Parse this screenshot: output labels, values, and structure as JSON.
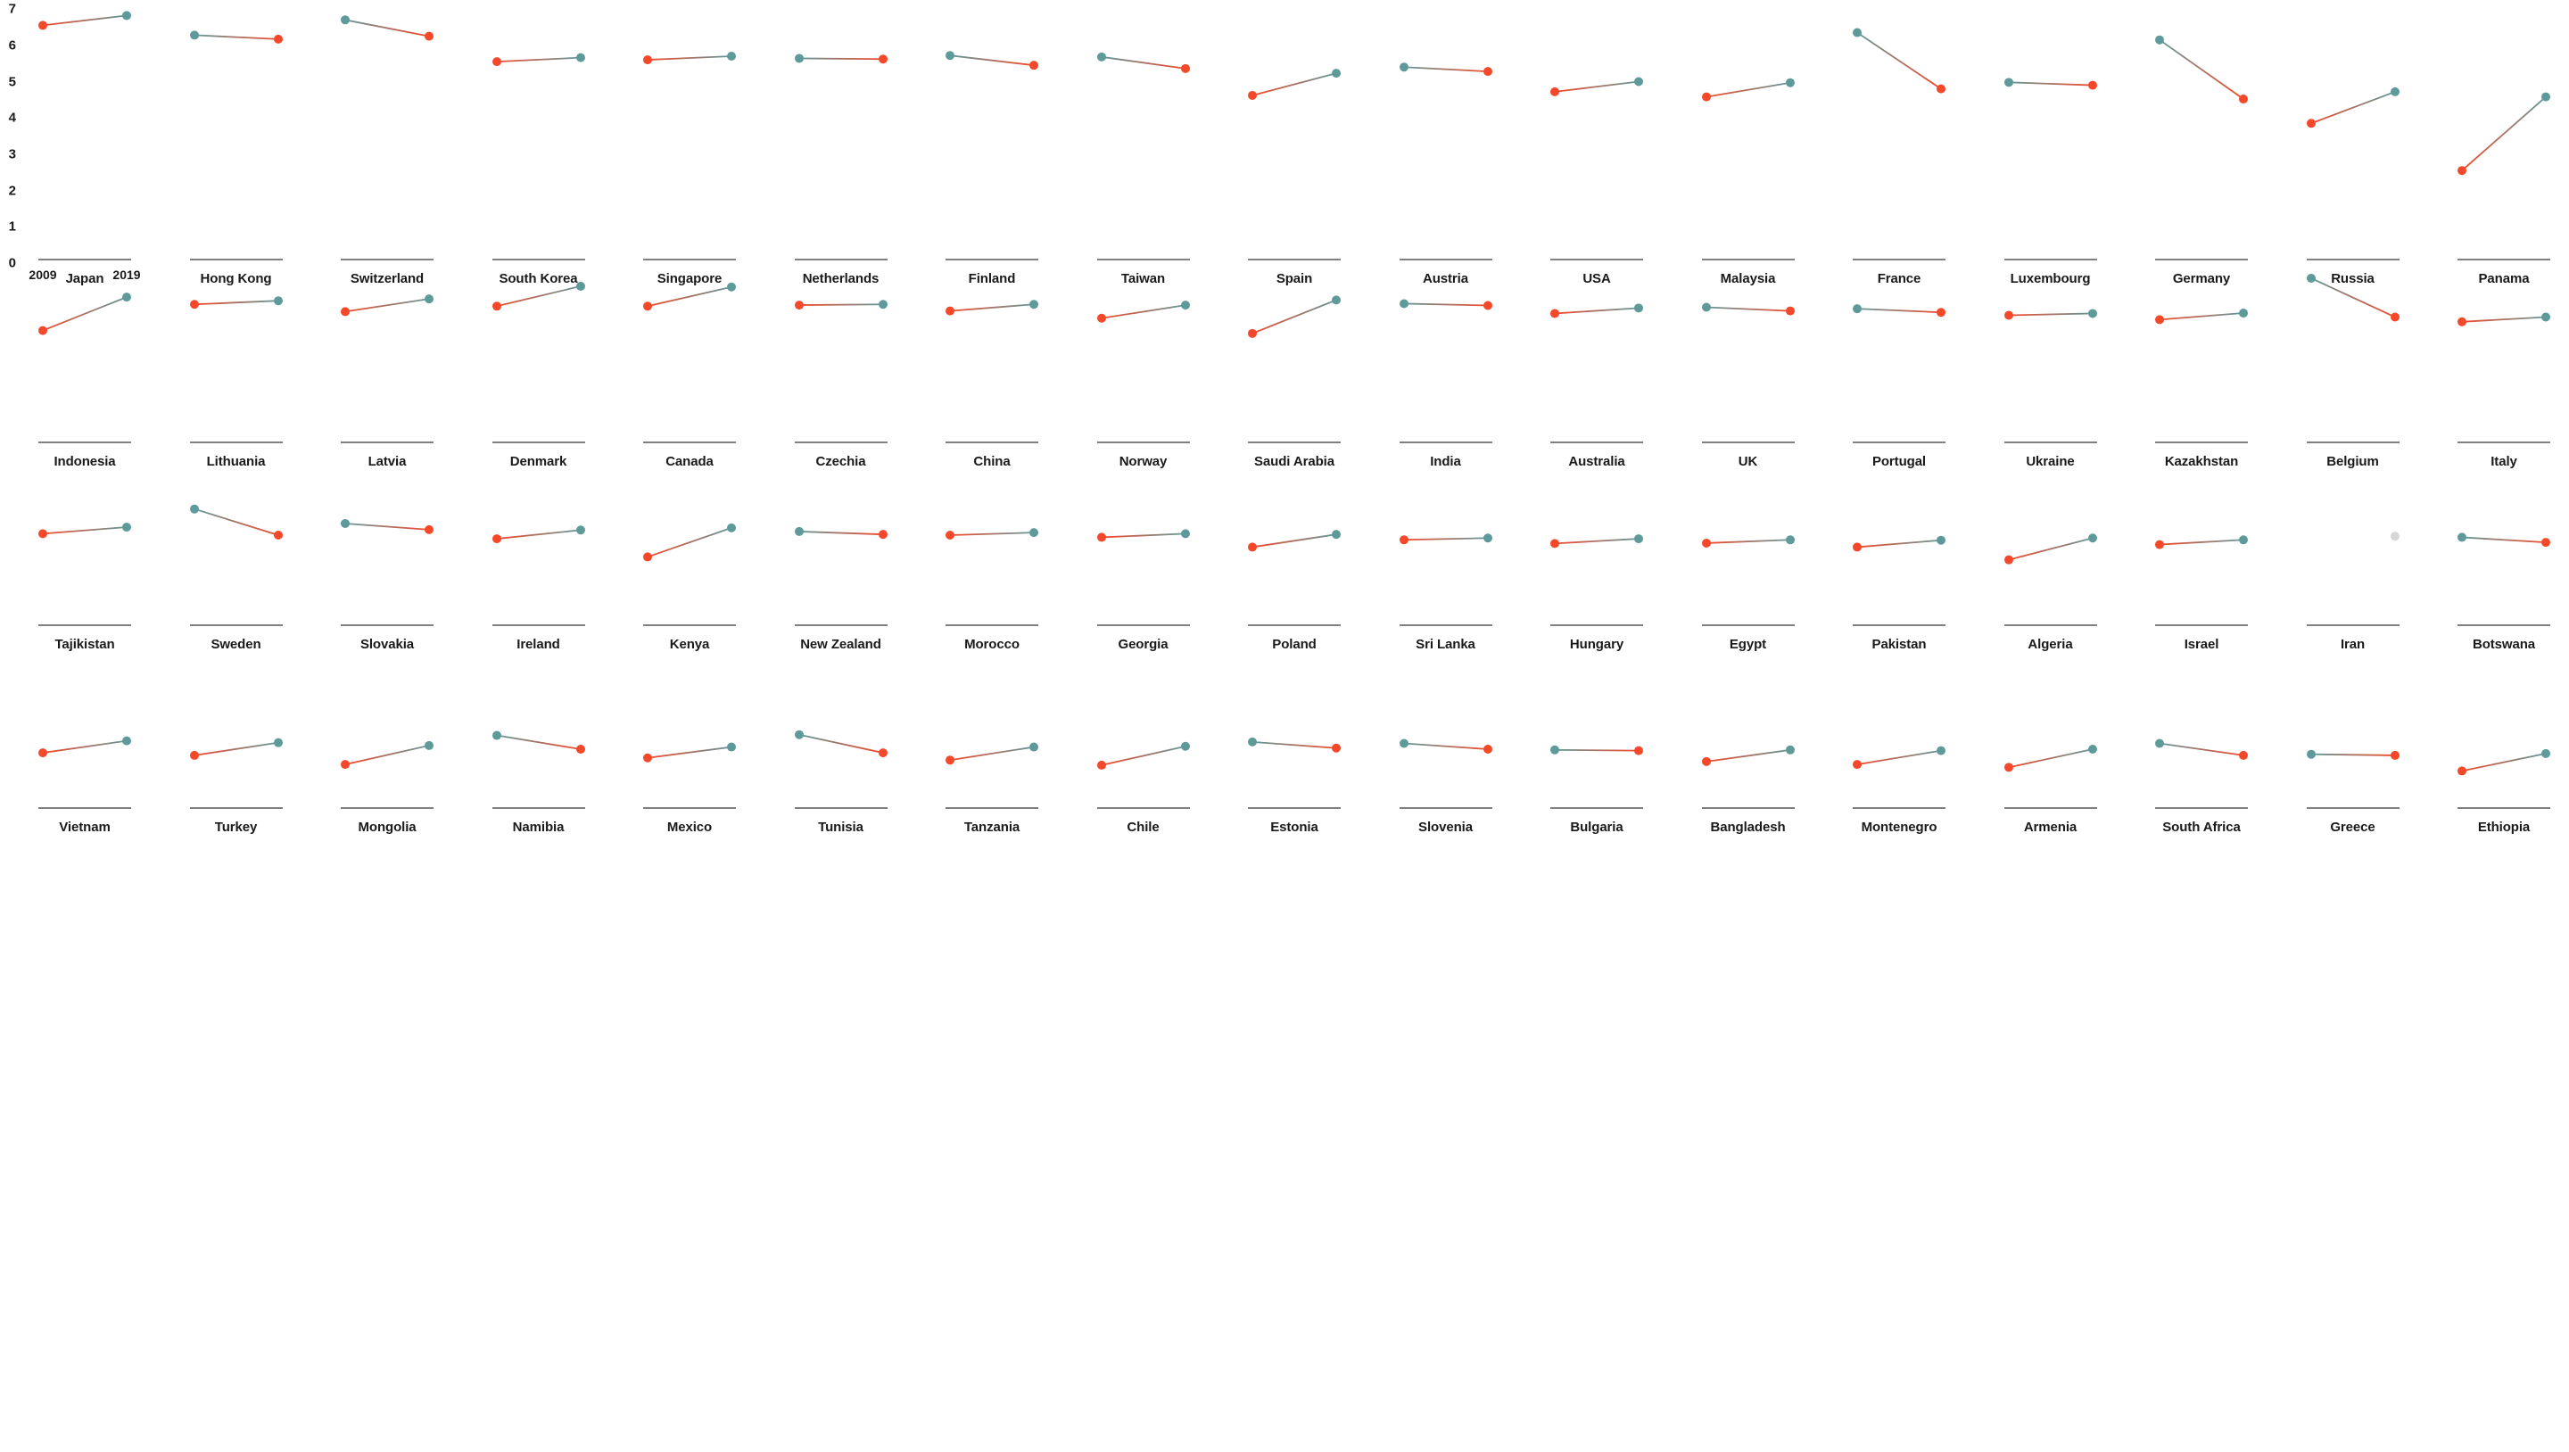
{
  "chart_data": {
    "type": "line",
    "title": "",
    "subtitle": "",
    "xlabel": "",
    "ylabel": "",
    "x": [
      2009,
      2019
    ],
    "x_tick_labels": [
      "2009",
      "2019"
    ],
    "ylim": [
      0,
      7
    ],
    "y_tick_labels": [
      "0",
      "1",
      "2",
      "3",
      "4",
      "5",
      "6",
      "7"
    ],
    "y_ticks": [
      0,
      1,
      2,
      3,
      4,
      5,
      6,
      7
    ],
    "grid": false,
    "legend_position": "none",
    "colors": {
      "low_point": "#f4482a",
      "high_point": "#5f9a9b",
      "missing_point": "#d6d6d6",
      "baseline": "#808080",
      "text": "#1a1a1a",
      "background": "#ffffff"
    },
    "encoding_note": "Red marker = lower of the two values; teal marker = higher of the two values; grey marker = single available value.",
    "columns_per_row": 17,
    "rows": 4,
    "series": [
      {
        "name": "Japan",
        "row": 0,
        "col": 0,
        "values": [
          6.55,
          6.82
        ]
      },
      {
        "name": "Hong Kong",
        "row": 0,
        "col": 1,
        "values": [
          6.28,
          6.17
        ]
      },
      {
        "name": "Switzerland",
        "row": 0,
        "col": 2,
        "values": [
          6.7,
          6.25
        ]
      },
      {
        "name": "South Korea",
        "row": 0,
        "col": 3,
        "values": [
          5.55,
          5.66
        ]
      },
      {
        "name": "Singapore",
        "row": 0,
        "col": 4,
        "values": [
          5.6,
          5.7
        ]
      },
      {
        "name": "Netherlands",
        "row": 0,
        "col": 5,
        "values": [
          5.64,
          5.62
        ]
      },
      {
        "name": "Finland",
        "row": 0,
        "col": 6,
        "values": [
          5.72,
          5.45
        ]
      },
      {
        "name": "Taiwan",
        "row": 0,
        "col": 7,
        "values": [
          5.68,
          5.36
        ]
      },
      {
        "name": "Spain",
        "row": 0,
        "col": 8,
        "values": [
          4.62,
          5.23
        ]
      },
      {
        "name": "Austria",
        "row": 0,
        "col": 9,
        "values": [
          5.4,
          5.28
        ]
      },
      {
        "name": "USA",
        "row": 0,
        "col": 10,
        "values": [
          4.72,
          5.0
        ]
      },
      {
        "name": "Malaysia",
        "row": 0,
        "col": 11,
        "values": [
          4.58,
          4.97
        ]
      },
      {
        "name": "France",
        "row": 0,
        "col": 12,
        "values": [
          6.35,
          4.8
        ]
      },
      {
        "name": "Luxembourg",
        "row": 0,
        "col": 13,
        "values": [
          4.98,
          4.9
        ]
      },
      {
        "name": "Germany",
        "row": 0,
        "col": 14,
        "values": [
          6.15,
          4.52
        ]
      },
      {
        "name": "Russia",
        "row": 0,
        "col": 15,
        "values": [
          3.85,
          4.72
        ]
      },
      {
        "name": "Panama",
        "row": 0,
        "col": 16,
        "values": [
          2.55,
          4.58
        ]
      },
      {
        "name": "Indonesia",
        "row": 1,
        "col": 0,
        "values": [
          3.18,
          4.1
        ]
      },
      {
        "name": "Lithuania",
        "row": 1,
        "col": 1,
        "values": [
          3.9,
          4.0
        ]
      },
      {
        "name": "Latvia",
        "row": 1,
        "col": 2,
        "values": [
          3.7,
          4.05
        ]
      },
      {
        "name": "Denmark",
        "row": 1,
        "col": 3,
        "values": [
          3.85,
          4.4
        ]
      },
      {
        "name": "Canada",
        "row": 1,
        "col": 4,
        "values": [
          3.85,
          4.38
        ]
      },
      {
        "name": "Czechia",
        "row": 1,
        "col": 5,
        "values": [
          3.88,
          3.9
        ]
      },
      {
        "name": "China",
        "row": 1,
        "col": 6,
        "values": [
          3.72,
          3.9
        ]
      },
      {
        "name": "Norway",
        "row": 1,
        "col": 7,
        "values": [
          3.52,
          3.88
        ]
      },
      {
        "name": "Saudi Arabia",
        "row": 1,
        "col": 8,
        "values": [
          3.1,
          4.02
        ]
      },
      {
        "name": "India",
        "row": 1,
        "col": 9,
        "values": [
          3.92,
          3.87
        ]
      },
      {
        "name": "Australia",
        "row": 1,
        "col": 10,
        "values": [
          3.65,
          3.8
        ]
      },
      {
        "name": "UK",
        "row": 1,
        "col": 11,
        "values": [
          3.82,
          3.72
        ]
      },
      {
        "name": "Portugal",
        "row": 1,
        "col": 12,
        "values": [
          3.78,
          3.68
        ]
      },
      {
        "name": "Ukraine",
        "row": 1,
        "col": 13,
        "values": [
          3.6,
          3.65
        ]
      },
      {
        "name": "Kazakhstan",
        "row": 1,
        "col": 14,
        "values": [
          3.48,
          3.66
        ]
      },
      {
        "name": "Belgium",
        "row": 1,
        "col": 15,
        "values": [
          4.62,
          3.55
        ]
      },
      {
        "name": "Italy",
        "row": 1,
        "col": 16,
        "values": [
          3.42,
          3.55
        ]
      },
      {
        "name": "Tajikistan",
        "row": 2,
        "col": 0,
        "values": [
          2.62,
          2.8
        ]
      },
      {
        "name": "Sweden",
        "row": 2,
        "col": 1,
        "values": [
          3.3,
          2.58
        ]
      },
      {
        "name": "Slovakia",
        "row": 2,
        "col": 2,
        "values": [
          2.9,
          2.73
        ]
      },
      {
        "name": "Ireland",
        "row": 2,
        "col": 3,
        "values": [
          2.48,
          2.72
        ]
      },
      {
        "name": "Kenya",
        "row": 2,
        "col": 4,
        "values": [
          1.98,
          2.78
        ]
      },
      {
        "name": "New Zealand",
        "row": 2,
        "col": 5,
        "values": [
          2.68,
          2.6
        ]
      },
      {
        "name": "Morocco",
        "row": 2,
        "col": 6,
        "values": [
          2.58,
          2.65
        ]
      },
      {
        "name": "Georgia",
        "row": 2,
        "col": 7,
        "values": [
          2.52,
          2.62
        ]
      },
      {
        "name": "Poland",
        "row": 2,
        "col": 8,
        "values": [
          2.25,
          2.6
        ]
      },
      {
        "name": "Sri Lanka",
        "row": 2,
        "col": 9,
        "values": [
          2.45,
          2.5
        ]
      },
      {
        "name": "Hungary",
        "row": 2,
        "col": 10,
        "values": [
          2.35,
          2.48
        ]
      },
      {
        "name": "Egypt",
        "row": 2,
        "col": 11,
        "values": [
          2.36,
          2.45
        ]
      },
      {
        "name": "Pakistan",
        "row": 2,
        "col": 12,
        "values": [
          2.25,
          2.44
        ]
      },
      {
        "name": "Algeria",
        "row": 2,
        "col": 13,
        "values": [
          1.9,
          2.5
        ]
      },
      {
        "name": "Israel",
        "row": 2,
        "col": 14,
        "values": [
          2.32,
          2.45
        ]
      },
      {
        "name": "Iran",
        "row": 2,
        "col": 15,
        "values": [
          null,
          2.55
        ]
      },
      {
        "name": "Botswana",
        "row": 2,
        "col": 16,
        "values": [
          2.52,
          2.38
        ]
      },
      {
        "name": "Vietnam",
        "row": 3,
        "col": 0,
        "values": [
          1.62,
          1.95
        ]
      },
      {
        "name": "Turkey",
        "row": 3,
        "col": 1,
        "values": [
          1.55,
          1.9
        ]
      },
      {
        "name": "Mongolia",
        "row": 3,
        "col": 2,
        "values": [
          1.3,
          1.82
        ]
      },
      {
        "name": "Namibia",
        "row": 3,
        "col": 3,
        "values": [
          2.1,
          1.72
        ]
      },
      {
        "name": "Mexico",
        "row": 3,
        "col": 4,
        "values": [
          1.48,
          1.78
        ]
      },
      {
        "name": "Tunisia",
        "row": 3,
        "col": 5,
        "values": [
          2.12,
          1.62
        ]
      },
      {
        "name": "Tanzania",
        "row": 3,
        "col": 6,
        "values": [
          1.42,
          1.78
        ]
      },
      {
        "name": "Chile",
        "row": 3,
        "col": 7,
        "values": [
          1.28,
          1.8
        ]
      },
      {
        "name": "Estonia",
        "row": 3,
        "col": 8,
        "values": [
          1.92,
          1.75
        ]
      },
      {
        "name": "Slovenia",
        "row": 3,
        "col": 9,
        "values": [
          1.88,
          1.72
        ]
      },
      {
        "name": "Bulgaria",
        "row": 3,
        "col": 10,
        "values": [
          1.7,
          1.68
        ]
      },
      {
        "name": "Bangladesh",
        "row": 3,
        "col": 11,
        "values": [
          1.38,
          1.7
        ]
      },
      {
        "name": "Montenegro",
        "row": 3,
        "col": 12,
        "values": [
          1.3,
          1.68
        ]
      },
      {
        "name": "Armenia",
        "row": 3,
        "col": 13,
        "values": [
          1.22,
          1.72
        ]
      },
      {
        "name": "South Africa",
        "row": 3,
        "col": 14,
        "values": [
          1.88,
          1.55
        ]
      },
      {
        "name": "Greece",
        "row": 3,
        "col": 15,
        "values": [
          1.58,
          1.55
        ]
      },
      {
        "name": "Ethiopia",
        "row": 3,
        "col": 16,
        "values": [
          1.12,
          1.6
        ]
      }
    ]
  }
}
